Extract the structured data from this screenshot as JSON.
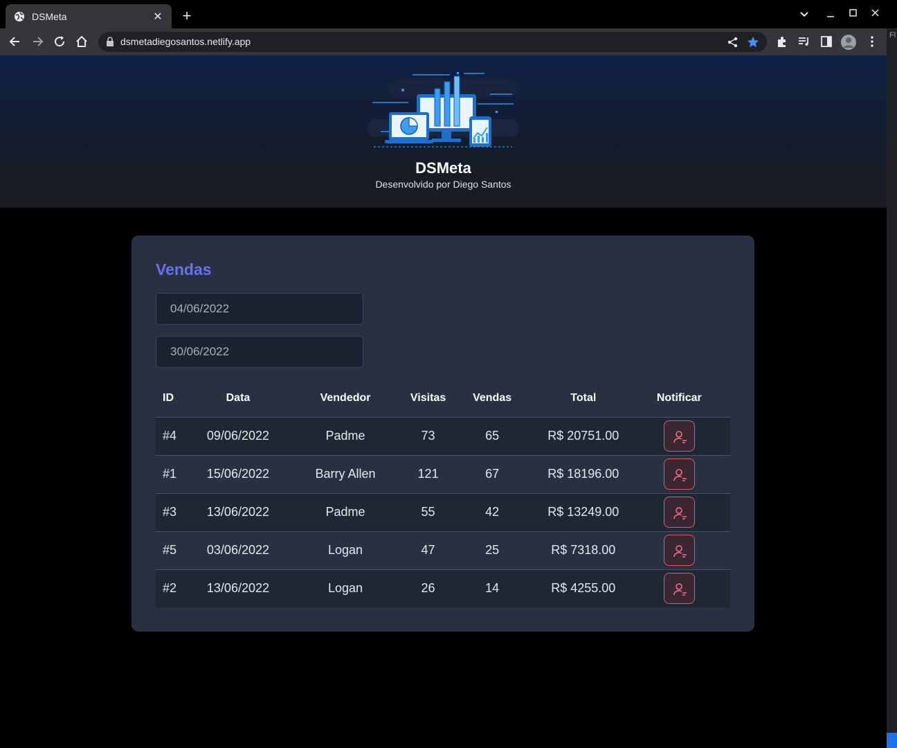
{
  "browser": {
    "tab_title": "DSMeta",
    "tab_close": "✕",
    "new_tab": "+",
    "url": "dsmetadiegosantos.netlify.app",
    "side_panel_text": "Fl"
  },
  "header": {
    "brand": "DSMeta",
    "tagline": "Desenvolvido por Diego Santos"
  },
  "sales_card": {
    "title": "Vendas",
    "min_date": "04/06/2022",
    "max_date": "30/06/2022",
    "columns": {
      "id": "ID",
      "date": "Data",
      "seller": "Vendedor",
      "visits": "Visitas",
      "deals": "Vendas",
      "total": "Total",
      "notify": "Notificar"
    },
    "rows": [
      {
        "id": "#4",
        "date": "09/06/2022",
        "seller": "Padme",
        "visits": "73",
        "deals": "65",
        "total": "R$ 20751.00"
      },
      {
        "id": "#1",
        "date": "15/06/2022",
        "seller": "Barry Allen",
        "visits": "121",
        "deals": "67",
        "total": "R$ 18196.00"
      },
      {
        "id": "#3",
        "date": "13/06/2022",
        "seller": "Padme",
        "visits": "55",
        "deals": "42",
        "total": "R$ 13249.00"
      },
      {
        "id": "#5",
        "date": "03/06/2022",
        "seller": "Logan",
        "visits": "47",
        "deals": "25",
        "total": "R$ 7318.00"
      },
      {
        "id": "#2",
        "date": "13/06/2022",
        "seller": "Logan",
        "visits": "26",
        "deals": "14",
        "total": "R$ 4255.00"
      }
    ]
  },
  "colors": {
    "accent": "#6b71ec",
    "notify_border": "#e0596c",
    "card_bg": "#283142"
  }
}
